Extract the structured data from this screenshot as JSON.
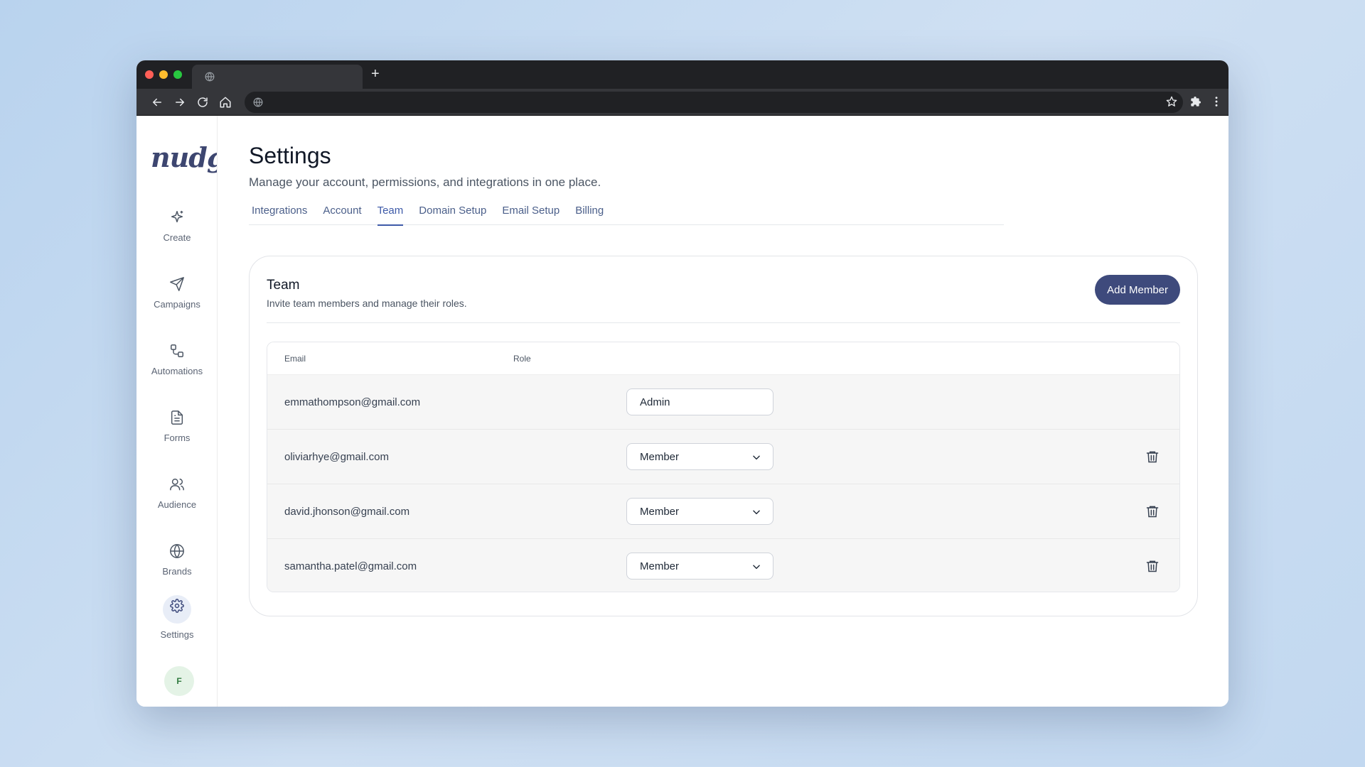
{
  "browser": {
    "new_tab_label": "+",
    "icons": [
      "globe-icon",
      "back-icon",
      "forward-icon",
      "reload-icon",
      "home-icon",
      "star-icon",
      "extensions-icon",
      "menu-icon"
    ]
  },
  "sidebar": {
    "logo": "nudge",
    "items": [
      {
        "label": "Create",
        "icon": "sparkle-icon"
      },
      {
        "label": "Campaigns",
        "icon": "send-icon"
      },
      {
        "label": "Automations",
        "icon": "workflow-icon"
      },
      {
        "label": "Forms",
        "icon": "document-icon"
      },
      {
        "label": "Audience",
        "icon": "users-icon"
      },
      {
        "label": "Brands",
        "icon": "globe-icon"
      },
      {
        "label": "Settings",
        "icon": "gear-icon",
        "active": true
      }
    ],
    "avatar_initial": "F"
  },
  "page": {
    "title": "Settings",
    "subtitle": "Manage your account, permissions, and integrations in one place."
  },
  "tabs": [
    {
      "label": "Integrations"
    },
    {
      "label": "Account"
    },
    {
      "label": "Team",
      "active": true
    },
    {
      "label": "Domain Setup"
    },
    {
      "label": "Email Setup"
    },
    {
      "label": "Billing"
    }
  ],
  "team_card": {
    "title": "Team",
    "subtitle": "Invite team members and manage their roles.",
    "add_button": "Add Member",
    "columns": {
      "email": "Email",
      "role": "Role"
    },
    "members": [
      {
        "email": "emmathompson@gmail.com",
        "role": "Admin",
        "editable": false
      },
      {
        "email": "oliviarhye@gmail.com",
        "role": "Member",
        "editable": true
      },
      {
        "email": "david.jhonson@gmail.com",
        "role": "Member",
        "editable": true
      },
      {
        "email": "samantha.patel@gmail.com",
        "role": "Member",
        "editable": true
      }
    ]
  },
  "colors": {
    "accent": "#3e5aa8",
    "button": "#3e4a7c",
    "browser_chrome": "#202124"
  }
}
